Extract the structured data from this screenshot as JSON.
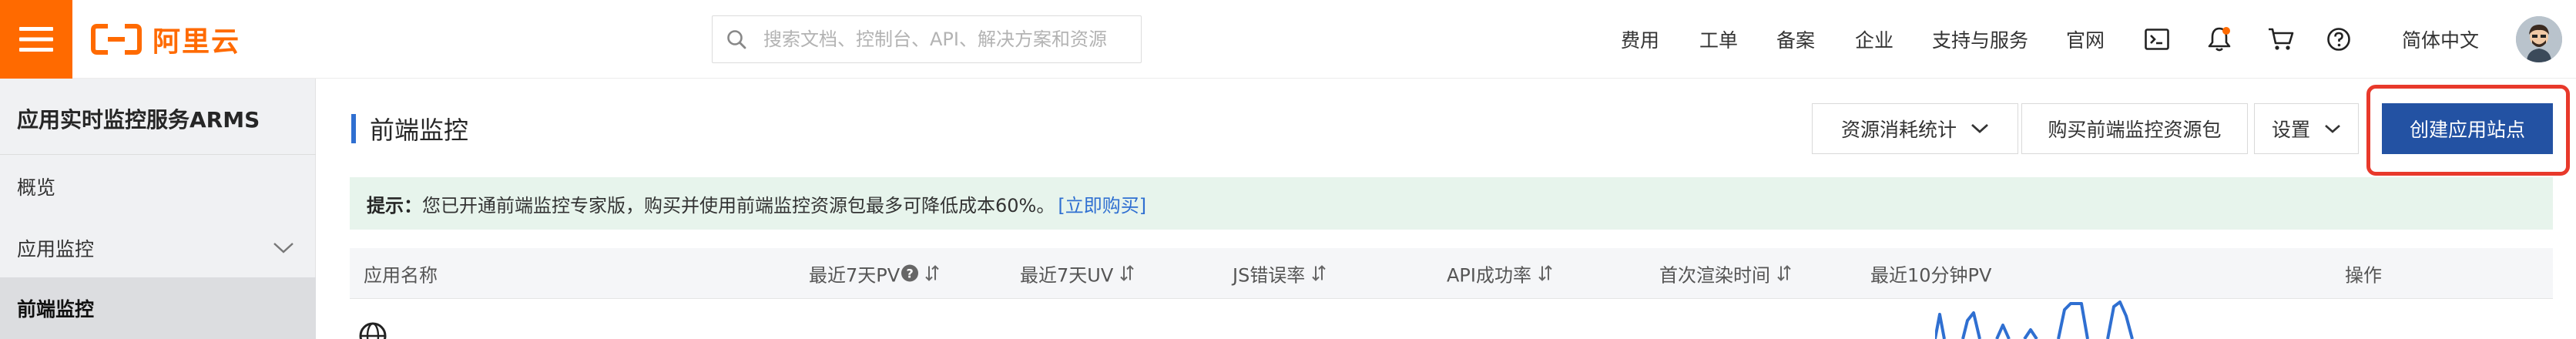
{
  "brand": {
    "logo_text": "阿里云",
    "accent_color": "#ff6a00"
  },
  "search": {
    "placeholder": "搜索文档、控制台、API、解决方案和资源"
  },
  "topnav": {
    "items": [
      "费用",
      "工单",
      "备案",
      "企业",
      "支持与服务",
      "官网"
    ],
    "language": "简体中文",
    "icons": [
      "terminal-icon",
      "bell-icon",
      "cart-icon",
      "help-icon"
    ]
  },
  "sidebar": {
    "title": "应用实时监控服务ARMS",
    "items": [
      {
        "label": "概览"
      },
      {
        "label": "应用监控"
      },
      {
        "label": "前端监控"
      }
    ]
  },
  "main": {
    "title": "前端监控",
    "buttons": {
      "usage_stats": "资源消耗统计",
      "buy_package": "购买前端监控资源包",
      "settings": "设置",
      "create_site": "创建应用站点"
    },
    "notice": {
      "prefix": "提示：",
      "text": "您已开通前端监控专家版，购买并使用前端监控资源包最多可降低成本60%。",
      "link": "[立即购买]"
    },
    "table": {
      "columns": [
        "应用名称",
        "最近7天PV",
        "最近7天UV",
        "JS错误率",
        "API成功率",
        "首次渲染时间",
        "最近10分钟PV",
        "操作"
      ]
    }
  },
  "colors": {
    "primary": "#2352a3",
    "notice_bg": "#e7f4ec",
    "highlight": "#e8392b",
    "link": "#2f6fd1"
  }
}
